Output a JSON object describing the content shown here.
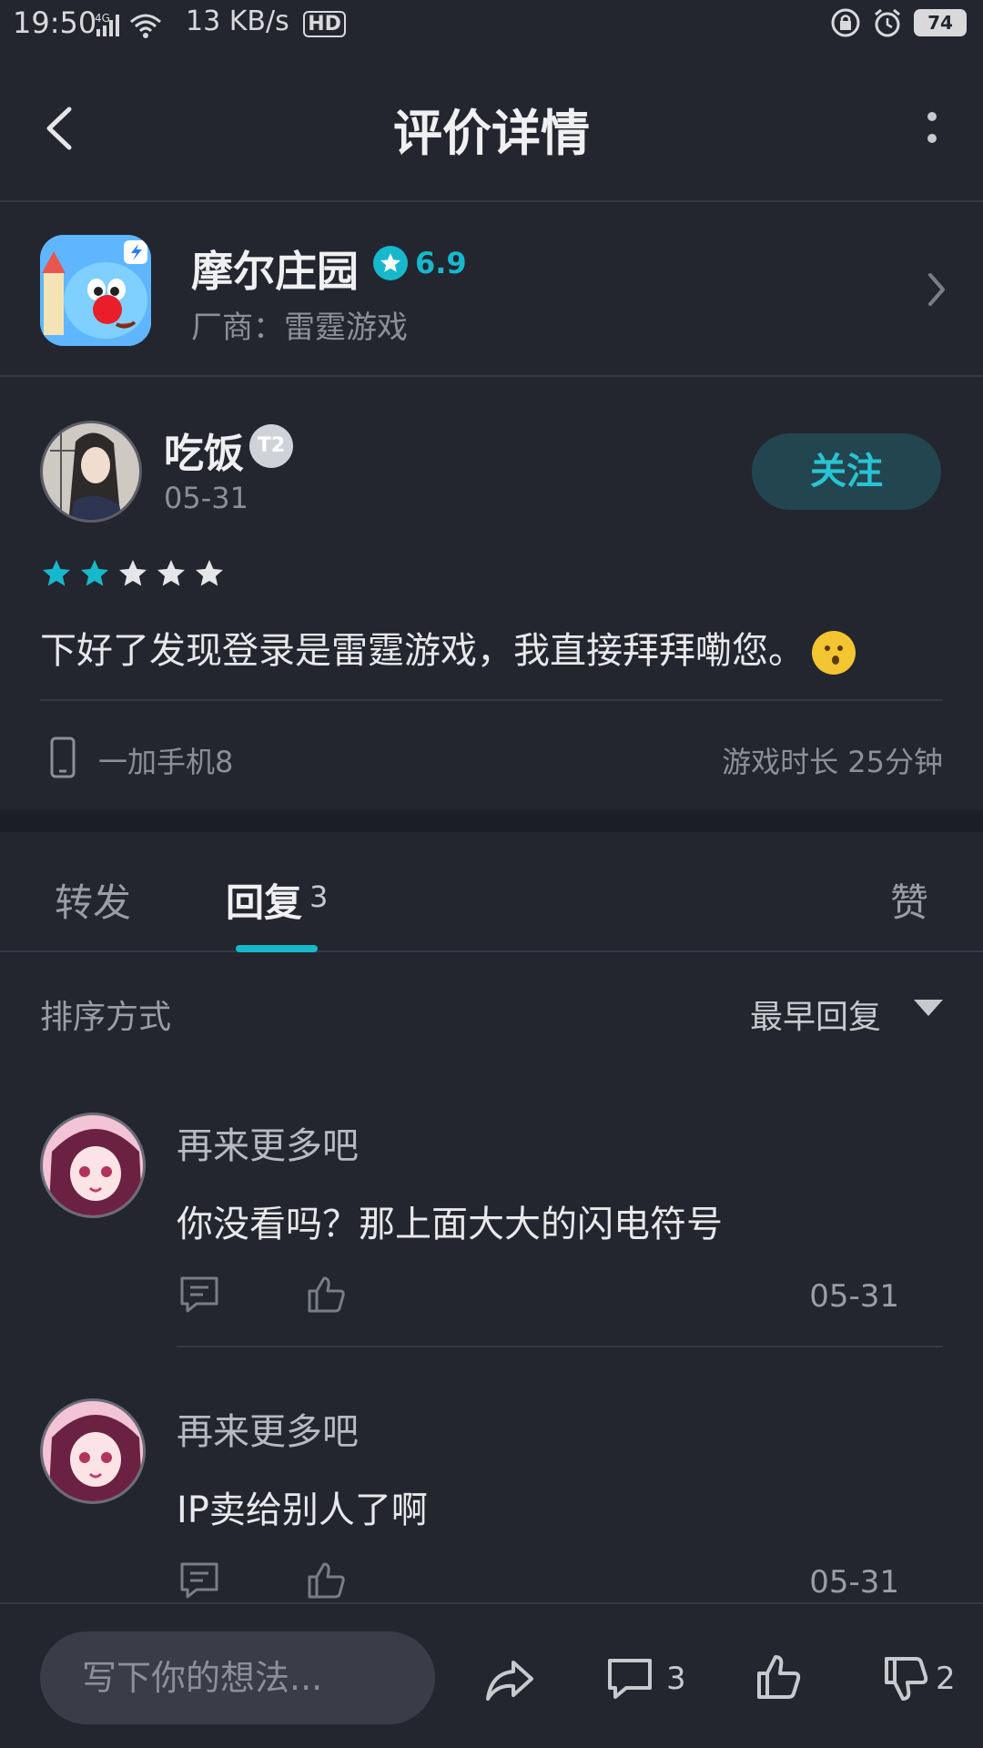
{
  "status_bar": {
    "time": "19:50",
    "network": "4G",
    "speed": "13 KB/s",
    "hd": "HD",
    "battery": "74"
  },
  "header": {
    "title": "评价详情"
  },
  "game": {
    "name": "摩尔庄园",
    "rating": "6.9",
    "vendor": "厂商：雷霆游戏"
  },
  "review": {
    "author": "吃饭",
    "level_badge": "T2",
    "date": "05-31",
    "follow_label": "关注",
    "stars_filled": 2,
    "stars_total": 5,
    "text": "下好了发现登录是雷霆游戏，我直接拜拜嘞您。",
    "device": "一加手机8",
    "playtime": "游戏时长 25分钟"
  },
  "tabs": {
    "forward": "转发",
    "reply": "回复",
    "reply_count": "3",
    "like": "赞"
  },
  "sort": {
    "label": "排序方式",
    "value": "最早回复"
  },
  "replies": [
    {
      "author": "再来更多吧",
      "text": "你没看吗？那上面大大的闪电符号",
      "date": "05-31"
    },
    {
      "author": "再来更多吧",
      "text": "IP卖给别人了啊",
      "date": "05-31"
    }
  ],
  "bottom_bar": {
    "input_placeholder": "写下你的想法...",
    "comment_count": "3",
    "dislike_count": "2"
  },
  "colors": {
    "accent": "#18b8cc",
    "background": "#23262f",
    "star_filled": "#18b8cc",
    "star_empty": "#e6e6e8"
  }
}
